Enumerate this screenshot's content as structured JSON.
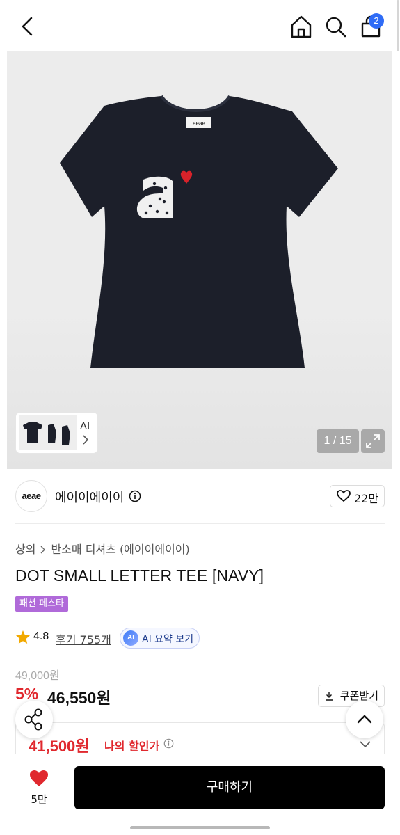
{
  "header": {
    "back_icon": "chevron-left-icon",
    "home_icon": "home-icon",
    "search_icon": "search-icon",
    "cart_icon": "shopping-bag-icon",
    "cart_count": "2",
    "badge_color": "#2f6cf6"
  },
  "gallery": {
    "ai_label": "AI",
    "counter": "1 / 15",
    "expand_icon": "expand-icon",
    "tag_logo": "aeae"
  },
  "brand": {
    "logo_text": "aeae",
    "name": "에이이에이이",
    "info_icon": "info-icon",
    "like_count": "22만"
  },
  "breadcrumb": {
    "category": "상의",
    "subcategory": "반소매 티셔츠 (에이이에이이)"
  },
  "product": {
    "title": "DOT SMALL LETTER TEE [NAVY]",
    "promo_badge": "패션 페스타",
    "promo_color": "#b06ad9",
    "rating": "4.8",
    "reviews": "후기 755개",
    "ai_summary": "AI 요약 보기",
    "ai_badge": "AI"
  },
  "price": {
    "original": "49,000원",
    "discount_rate": "5%",
    "sale": "46,550원",
    "coupon_label": "쿠폰받기",
    "my_price": "41,500원",
    "my_price_label": "나의 할인가",
    "accent_color": "#e0282e"
  },
  "bottom": {
    "wish_count": "5만",
    "buy_label": "구매하기"
  }
}
